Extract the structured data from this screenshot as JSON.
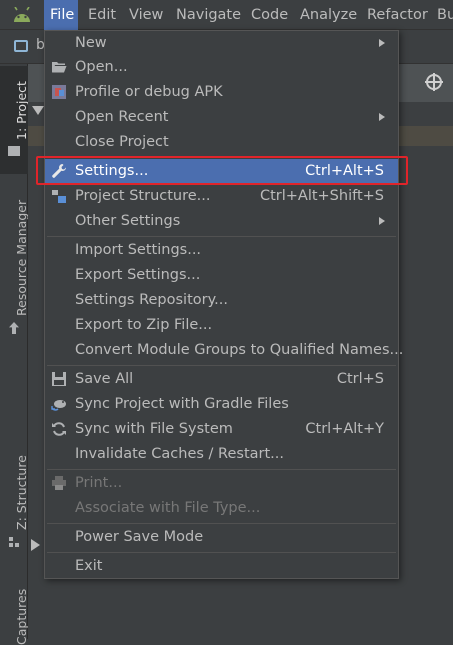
{
  "menubar": {
    "items": [
      {
        "label": "File",
        "active": true
      },
      {
        "label": "Edit"
      },
      {
        "label": "View"
      },
      {
        "label": "Navigate"
      },
      {
        "label": "Code"
      },
      {
        "label": "Analyze"
      },
      {
        "label": "Refactor"
      },
      {
        "label": "Bu"
      }
    ]
  },
  "navbar": {
    "crumb": "b"
  },
  "tool_strip": {
    "project_tab": "1: Project",
    "resource_manager_tab": "Resource Manager",
    "structure_tab": "Z: Structure",
    "captures_tab": "Captures"
  },
  "file_menu": {
    "items": [
      {
        "label": "New",
        "submenu": true
      },
      {
        "label": "Open...",
        "icon": "folder-open-icon"
      },
      {
        "label": "Profile or debug APK",
        "icon": "apk-icon"
      },
      {
        "label": "Open Recent",
        "submenu": true
      },
      {
        "label": "Close Project"
      },
      {
        "label": "Settings...",
        "shortcut": "Ctrl+Alt+S",
        "icon": "wrench-icon",
        "selected": true
      },
      {
        "label": "Project Structure...",
        "shortcut": "Ctrl+Alt+Shift+S",
        "icon": "project-structure-icon"
      },
      {
        "label": "Other Settings",
        "submenu": true
      },
      {
        "label": "Import Settings..."
      },
      {
        "label": "Export Settings..."
      },
      {
        "label": "Settings Repository..."
      },
      {
        "label": "Export to Zip File..."
      },
      {
        "label": "Convert Module Groups to Qualified Names..."
      },
      {
        "label": "Save All",
        "shortcut": "Ctrl+S",
        "icon": "save-icon"
      },
      {
        "label": "Sync Project with Gradle Files",
        "icon": "gradle-sync-icon"
      },
      {
        "label": "Sync with File System",
        "shortcut": "Ctrl+Alt+Y",
        "icon": "refresh-icon"
      },
      {
        "label": "Invalidate Caches / Restart..."
      },
      {
        "label": "Print...",
        "icon": "print-icon",
        "disabled": true
      },
      {
        "label": "Associate with File Type...",
        "disabled": true
      },
      {
        "label": "Power Save Mode"
      },
      {
        "label": "Exit"
      }
    ]
  },
  "colors": {
    "menu_bg": "#3c3f41",
    "selection": "#4b6eaf",
    "highlight_box": "#e0242a",
    "text": "#bbbbbb",
    "disabled_text": "#777777"
  }
}
